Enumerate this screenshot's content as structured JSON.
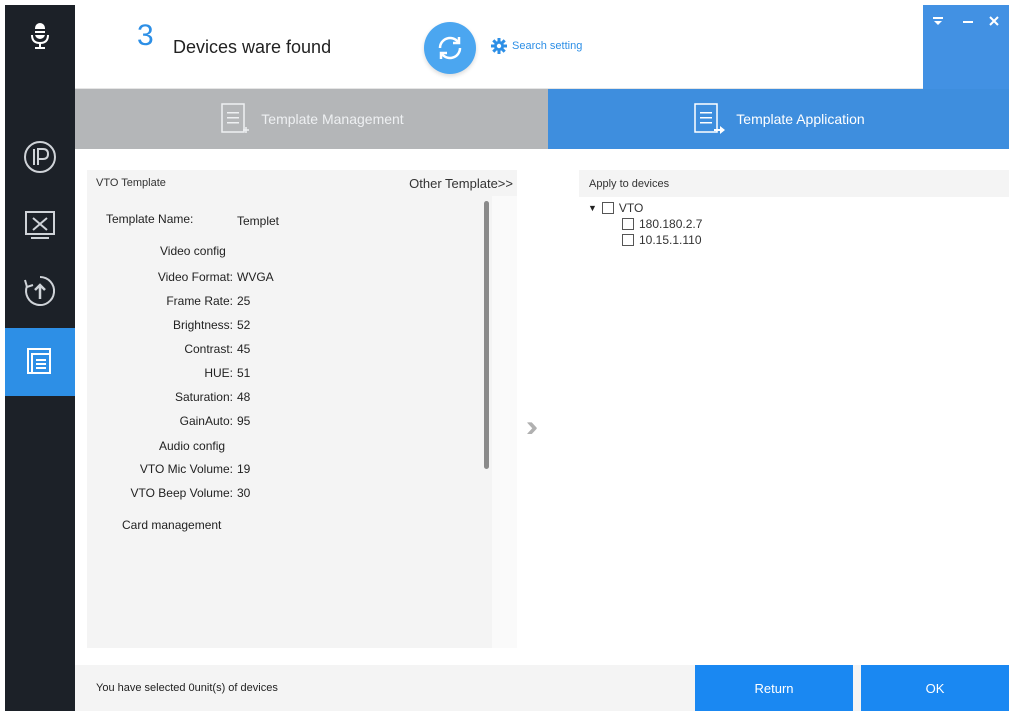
{
  "header": {
    "device_count": "3",
    "found_text": "Devices ware found",
    "search_setting": "Search setting",
    "window_controls": [
      "menu-icon",
      "minimize-icon",
      "close-icon"
    ]
  },
  "sidebar": {
    "items": [
      {
        "icon": "microphone-icon"
      },
      {
        "icon": "ip-icon"
      },
      {
        "icon": "tools-icon"
      },
      {
        "icon": "upgrade-icon"
      },
      {
        "icon": "template-icon",
        "active": true
      }
    ]
  },
  "tabs": [
    {
      "label": "Template Management",
      "active": false
    },
    {
      "label": "Template Application",
      "active": true
    }
  ],
  "template_panel": {
    "title": "VTO Template",
    "other_link": "Other Template>>",
    "name_label": "Template Name:",
    "name_value": "Templet",
    "video_section": "Video config",
    "video_fields": [
      {
        "label": "Video Format:",
        "value": "WVGA"
      },
      {
        "label": "Frame Rate:",
        "value": "25"
      },
      {
        "label": "Brightness:",
        "value": "52"
      },
      {
        "label": "Contrast:",
        "value": "45"
      },
      {
        "label": "HUE:",
        "value": "51"
      },
      {
        "label": "Saturation:",
        "value": "48"
      },
      {
        "label": "GainAuto:",
        "value": "95"
      }
    ],
    "audio_section": "Audio config",
    "audio_fields": [
      {
        "label": "VTO Mic Volume:",
        "value": "19"
      },
      {
        "label": "VTO Beep Volume:",
        "value": "30"
      }
    ],
    "card_section": "Card management"
  },
  "apply_panel": {
    "title": "Apply to devices",
    "group": "VTO",
    "devices": [
      "180.180.2.7",
      "10.15.1.110"
    ]
  },
  "footer": {
    "status": "You have selected 0unit(s) of devices",
    "return_label": "Return",
    "ok_label": "OK"
  },
  "colors": {
    "accent": "#2d8fe6",
    "sidebar_bg": "#1c2128",
    "tab_inactive": "#b4b6b8",
    "tab_active": "#3e8ede",
    "button": "#1a88f2"
  }
}
